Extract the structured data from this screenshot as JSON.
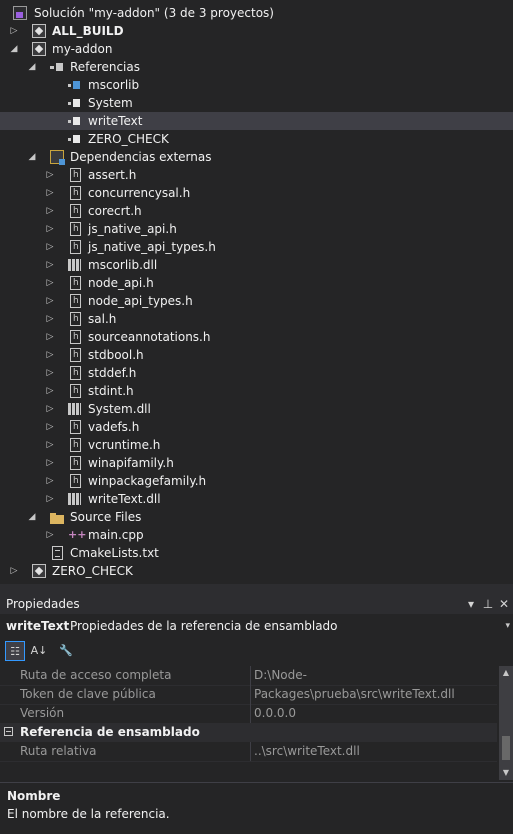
{
  "solution_explorer": {
    "rows": [
      {
        "label": "Solución \"my-addon\" (3 de 3 proyectos)",
        "icon": "solution-icon",
        "expander": "",
        "bold": false
      },
      {
        "label": "ALL_BUILD",
        "icon": "project-icon",
        "expander": "collapsed",
        "bold": true
      },
      {
        "label": "my-addon",
        "icon": "project-icon",
        "expander": "expanded",
        "bold": false
      },
      {
        "label": "Referencias",
        "icon": "references-icon",
        "expander": "expanded",
        "bold": false
      },
      {
        "label": "mscorlib",
        "icon": "assembly-icon",
        "expander": "",
        "bold": false
      },
      {
        "label": "System",
        "icon": "assembly-icon",
        "expander": "",
        "bold": false
      },
      {
        "label": "writeText",
        "icon": "assembly-icon",
        "expander": "",
        "bold": false,
        "selected": true
      },
      {
        "label": "ZERO_CHECK",
        "icon": "assembly-icon",
        "expander": "",
        "bold": false
      },
      {
        "label": "Dependencias externas",
        "icon": "external-dependencies-icon",
        "expander": "expanded",
        "bold": false
      },
      {
        "label": "assert.h",
        "icon": "header-file-icon",
        "expander": "collapsed",
        "bold": false
      },
      {
        "label": "concurrencysal.h",
        "icon": "header-file-icon",
        "expander": "collapsed",
        "bold": false
      },
      {
        "label": "corecrt.h",
        "icon": "header-file-icon",
        "expander": "collapsed",
        "bold": false
      },
      {
        "label": "js_native_api.h",
        "icon": "header-file-icon",
        "expander": "collapsed",
        "bold": false
      },
      {
        "label": "js_native_api_types.h",
        "icon": "header-file-icon",
        "expander": "collapsed",
        "bold": false
      },
      {
        "label": "mscorlib.dll",
        "icon": "dll-icon",
        "expander": "collapsed",
        "bold": false
      },
      {
        "label": "node_api.h",
        "icon": "header-file-icon",
        "expander": "collapsed",
        "bold": false
      },
      {
        "label": "node_api_types.h",
        "icon": "header-file-icon",
        "expander": "collapsed",
        "bold": false
      },
      {
        "label": "sal.h",
        "icon": "header-file-icon",
        "expander": "collapsed",
        "bold": false
      },
      {
        "label": "sourceannotations.h",
        "icon": "header-file-icon",
        "expander": "collapsed",
        "bold": false
      },
      {
        "label": "stdbool.h",
        "icon": "header-file-icon",
        "expander": "collapsed",
        "bold": false
      },
      {
        "label": "stddef.h",
        "icon": "header-file-icon",
        "expander": "collapsed",
        "bold": false
      },
      {
        "label": "stdint.h",
        "icon": "header-file-icon",
        "expander": "collapsed",
        "bold": false
      },
      {
        "label": "System.dll",
        "icon": "dll-icon",
        "expander": "collapsed",
        "bold": false
      },
      {
        "label": "vadefs.h",
        "icon": "header-file-icon",
        "expander": "collapsed",
        "bold": false
      },
      {
        "label": "vcruntime.h",
        "icon": "header-file-icon",
        "expander": "collapsed",
        "bold": false
      },
      {
        "label": "winapifamily.h",
        "icon": "header-file-icon",
        "expander": "collapsed",
        "bold": false
      },
      {
        "label": "winpackagefamily.h",
        "icon": "header-file-icon",
        "expander": "collapsed",
        "bold": false
      },
      {
        "label": "writeText.dll",
        "icon": "dll-icon",
        "expander": "collapsed",
        "bold": false
      },
      {
        "label": "Source Files",
        "icon": "folder-icon",
        "expander": "expanded",
        "bold": false
      },
      {
        "label": "main.cpp",
        "icon": "cpp-file-icon",
        "expander": "collapsed",
        "bold": false
      },
      {
        "label": "CmakeLists.txt",
        "icon": "text-file-icon",
        "expander": "",
        "bold": false
      },
      {
        "label": "ZERO_CHECK",
        "icon": "project-icon",
        "expander": "collapsed",
        "bold": false
      }
    ]
  },
  "properties": {
    "title": "Propiedades",
    "object_name": "writeText",
    "object_description": "Propiedades de la referencia de ensamblado",
    "rows_top": [
      {
        "name": "Ruta de acceso completa",
        "value": "D:\\Node-Packages\\prueba\\src\\writeText.dll"
      },
      {
        "name": "Token de clave pública",
        "value": ""
      },
      {
        "name": "Versión",
        "value": "0.0.0.0"
      }
    ],
    "category": "Referencia de ensamblado",
    "rows_bottom": [
      {
        "name": "Ruta relativa",
        "value": "..\\src\\writeText.dll"
      }
    ],
    "description_name": "Nombre",
    "description_text": "El nombre de la referencia."
  }
}
